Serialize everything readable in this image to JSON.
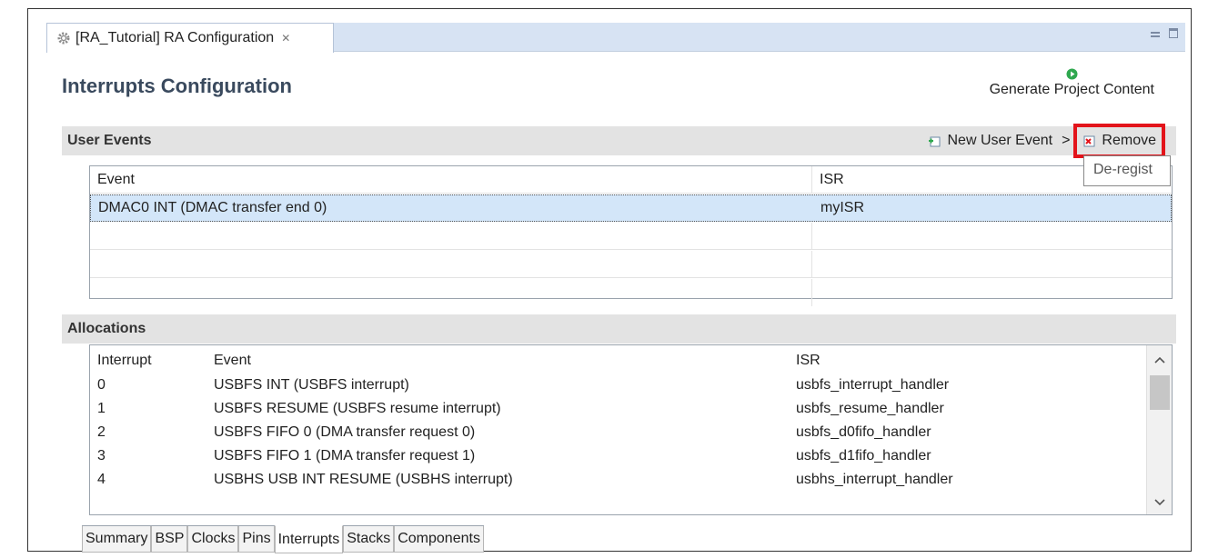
{
  "editor_tab": {
    "title": "[RA_Tutorial] RA Configuration",
    "close_glyph": "✕"
  },
  "page": {
    "title": "Interrupts Configuration"
  },
  "generate": {
    "label": "Generate Project Content",
    "icon": "run-icon",
    "icon_color": "#2fa84f"
  },
  "user_events": {
    "header": "User Events",
    "new_label": "New User Event",
    "new_separator": ">",
    "remove_label": "Remove",
    "highlight_color": "#e3141b",
    "tooltip": "De-regist",
    "columns": [
      "Event",
      "ISR"
    ],
    "rows": [
      {
        "event": "DMAC0 INT (DMAC transfer end 0)",
        "isr": "myISR"
      }
    ]
  },
  "allocations": {
    "header": "Allocations",
    "columns": [
      "Interrupt",
      "Event",
      "ISR"
    ],
    "rows": [
      {
        "interrupt": "0",
        "event": "USBFS INT (USBFS interrupt)",
        "isr": "usbfs_interrupt_handler"
      },
      {
        "interrupt": "1",
        "event": "USBFS RESUME (USBFS resume interrupt)",
        "isr": "usbfs_resume_handler"
      },
      {
        "interrupt": "2",
        "event": "USBFS FIFO 0 (DMA transfer request 0)",
        "isr": "usbfs_d0fifo_handler"
      },
      {
        "interrupt": "3",
        "event": "USBFS FIFO 1 (DMA transfer request 1)",
        "isr": "usbfs_d1fifo_handler"
      },
      {
        "interrupt": "4",
        "event": "USBHS USB INT RESUME (USBHS interrupt)",
        "isr": "usbhs_interrupt_handler"
      }
    ]
  },
  "bottom_tabs": [
    "Summary",
    "BSP",
    "Clocks",
    "Pins",
    "Interrupts",
    "Stacks",
    "Components"
  ],
  "active_tab": "Interrupts"
}
